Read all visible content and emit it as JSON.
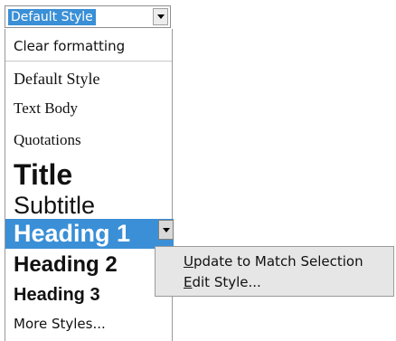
{
  "combo": {
    "selected": "Default Style"
  },
  "styles_list": {
    "clear_formatting": "Clear formatting",
    "items": [
      "Default Style",
      "Text Body",
      "Quotations",
      "Title",
      "Subtitle",
      "Heading 1",
      "Heading 2",
      "Heading 3"
    ],
    "more_styles": "More Styles..."
  },
  "context_menu": {
    "update": {
      "mnemonic": "U",
      "rest": "pdate to Match Selection"
    },
    "edit": {
      "mnemonic": "E",
      "rest": "dit Style..."
    }
  },
  "colors": {
    "selection": "#3a8fd6",
    "menu_bg": "#e6e6e6"
  },
  "icons": [
    "dropdown-arrow-icon"
  ]
}
